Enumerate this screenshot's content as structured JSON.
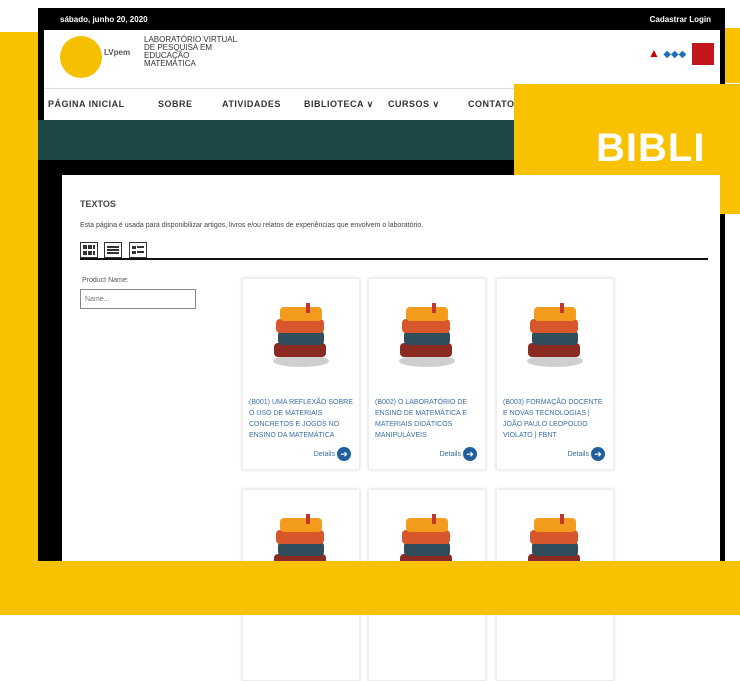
{
  "topbar": {
    "date": "sábado, junho 20, 2020",
    "links": "Cadastrar  Login"
  },
  "header": {
    "logo_text": "LVpem",
    "lab_name": [
      "LABORATÓRIO VIRTUAL",
      "DE PESQUISA EM",
      "EDUCAÇÃO",
      "MATEMÁTICA"
    ]
  },
  "nav": {
    "items": [
      "PÁGINA INICIAL",
      "SOBRE",
      "ATIVIDADES",
      "BIBLIOTECA ∨",
      "CURSOS ∨",
      "CONTATO"
    ]
  },
  "banner": {
    "text": "BIBLI"
  },
  "content": {
    "title": "TEXTOS",
    "description": "Esta página é usada para disponibilizar artigos, livros e/ou relatos de experiências que envolvem o laboratório.",
    "filter": {
      "label": "Product Name:",
      "placeholder": "Name..."
    },
    "cards": [
      {
        "title": "(B001) UMA REFLEXÃO SOBRE O USO DE MATERIAIS CONCRETOS E JOGOS NO ENSINO DA MATEMÁTICA",
        "details": "Details"
      },
      {
        "title": "(B002) O LABORATÓRIO DE ENSINO DE MATEMÁTICA E MATERIAIS DIDÁTICOS MANIPULÁVEIS",
        "details": "Details"
      },
      {
        "title": "(B003) FORMAÇÃO DOCENTE E NOVAS TECNOLOGIAS | JOÃO PAULO LEOPOLDO VIOLATO | FBNT",
        "details": "Details"
      },
      {
        "title": "",
        "details": ""
      },
      {
        "title": "",
        "details": ""
      },
      {
        "title": "",
        "details": ""
      }
    ]
  },
  "colors": {
    "accent_yellow": "#f8c200",
    "teal": "#1c4848",
    "link_blue": "#3a6ea5"
  }
}
